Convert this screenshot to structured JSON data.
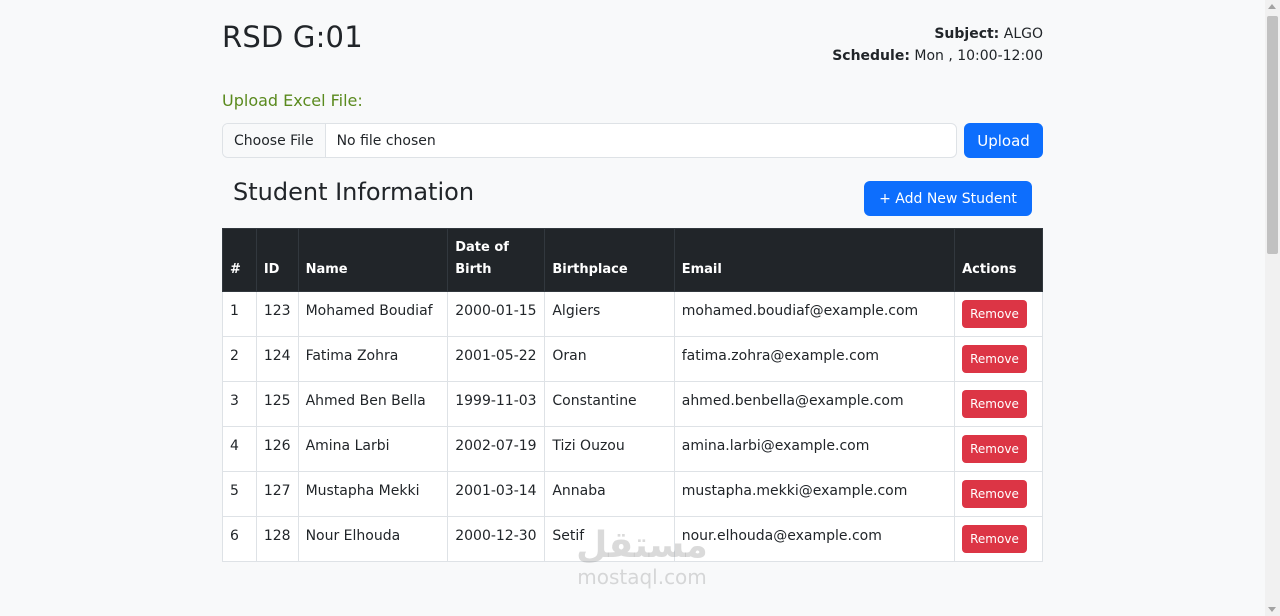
{
  "header": {
    "title": "RSD G:01",
    "subject_label": "Subject:",
    "subject_value": "ALGO",
    "schedule_label": "Schedule:",
    "schedule_value": "Mon , 10:00-12:00"
  },
  "upload": {
    "label": "Upload Excel File:",
    "choose_label": "Choose File",
    "status": "No file chosen",
    "button_label": "Upload"
  },
  "students": {
    "title": "Student Information",
    "add_label": "+ Add New Student",
    "columns": [
      "#",
      "ID",
      "Name",
      "Date of Birth",
      "Birthplace",
      "Email",
      "Actions"
    ],
    "rows": [
      {
        "num": "1",
        "id": "123",
        "name": "Mohamed Boudiaf",
        "dob": "2000-01-15",
        "birthplace": "Algiers",
        "email": "mohamed.boudiaf@example.com",
        "action": "Remove"
      },
      {
        "num": "2",
        "id": "124",
        "name": "Fatima Zohra",
        "dob": "2001-05-22",
        "birthplace": "Oran",
        "email": "fatima.zohra@example.com",
        "action": "Remove"
      },
      {
        "num": "3",
        "id": "125",
        "name": "Ahmed Ben Bella",
        "dob": "1999-11-03",
        "birthplace": "Constantine",
        "email": "ahmed.benbella@example.com",
        "action": "Remove"
      },
      {
        "num": "4",
        "id": "126",
        "name": "Amina Larbi",
        "dob": "2002-07-19",
        "birthplace": "Tizi Ouzou",
        "email": "amina.larbi@example.com",
        "action": "Remove"
      },
      {
        "num": "5",
        "id": "127",
        "name": "Mustapha Mekki",
        "dob": "2001-03-14",
        "birthplace": "Annaba",
        "email": "mustapha.mekki@example.com",
        "action": "Remove"
      },
      {
        "num": "6",
        "id": "128",
        "name": "Nour Elhouda",
        "dob": "2000-12-30",
        "birthplace": "Setif",
        "email": "nour.elhouda@example.com",
        "action": "Remove"
      }
    ]
  },
  "watermark": {
    "arabic": "مستقل",
    "latin": "mostaql.com"
  },
  "colors": {
    "primary": "#0d6efd",
    "danger": "#dc3545",
    "table_header": "#212529",
    "upload_label": "#5a8a1e"
  }
}
